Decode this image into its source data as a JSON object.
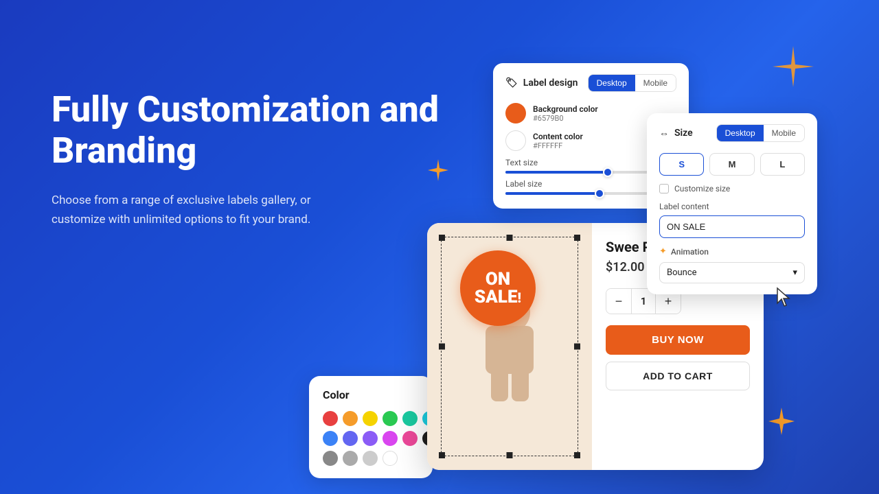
{
  "page": {
    "background": "#1a4fd6",
    "title": "Fully Customization and Branding",
    "subtitle": "Choose from a range of exclusive labels gallery, or customize with unlimited options to fit your brand."
  },
  "label_design_panel": {
    "header": "Label design",
    "tab_desktop": "Desktop",
    "tab_mobile": "Mobile",
    "bg_color_label": "Background color",
    "bg_color_hex": "#6579B0",
    "content_color_label": "Content color",
    "content_color_hex": "#FFFFFF",
    "text_size_label": "Text size",
    "label_size_label": "Label size",
    "bg_color_value": "#e85c1a",
    "content_color_value": "#ffffff",
    "text_slider_pct": 60,
    "label_slider_pct": 55
  },
  "size_panel": {
    "header": "Size",
    "tab_desktop": "Desktop",
    "tab_mobile": "Mobile",
    "sizes": [
      "S",
      "M",
      "L"
    ],
    "selected_size": "S",
    "customize_size_label": "Customize size",
    "label_content_label": "Label content",
    "label_content_value": "ON SALE ",
    "animation_icon": "✦",
    "animation_label": "Animation",
    "animation_value": "Bounce"
  },
  "product_card": {
    "name": "Swee Pal Dol",
    "price": "$12.00",
    "quantity": 1,
    "buy_now_label": "BUY NOW",
    "add_to_cart_label": "ADD TO CART",
    "badge_line1": "ON",
    "badge_line2": "SALE",
    "badge_exclaim": "!"
  },
  "color_panel": {
    "title": "Color",
    "colors": [
      "#e84040",
      "#f59c2a",
      "#f5d300",
      "#2ac952",
      "#1ac9a0",
      "#1acde0",
      "#2563eb",
      "#3b82f6",
      "#6366f1",
      "#8b5cf6",
      "#d946ef",
      "#ec4899",
      "#1e1e1e",
      "#555555",
      "#888888",
      "#aaaaaa",
      "#cccccc",
      "#ffffff"
    ]
  },
  "icons": {
    "label_icon": "🏷",
    "animation_icon": "✦",
    "cursor": "↖"
  }
}
